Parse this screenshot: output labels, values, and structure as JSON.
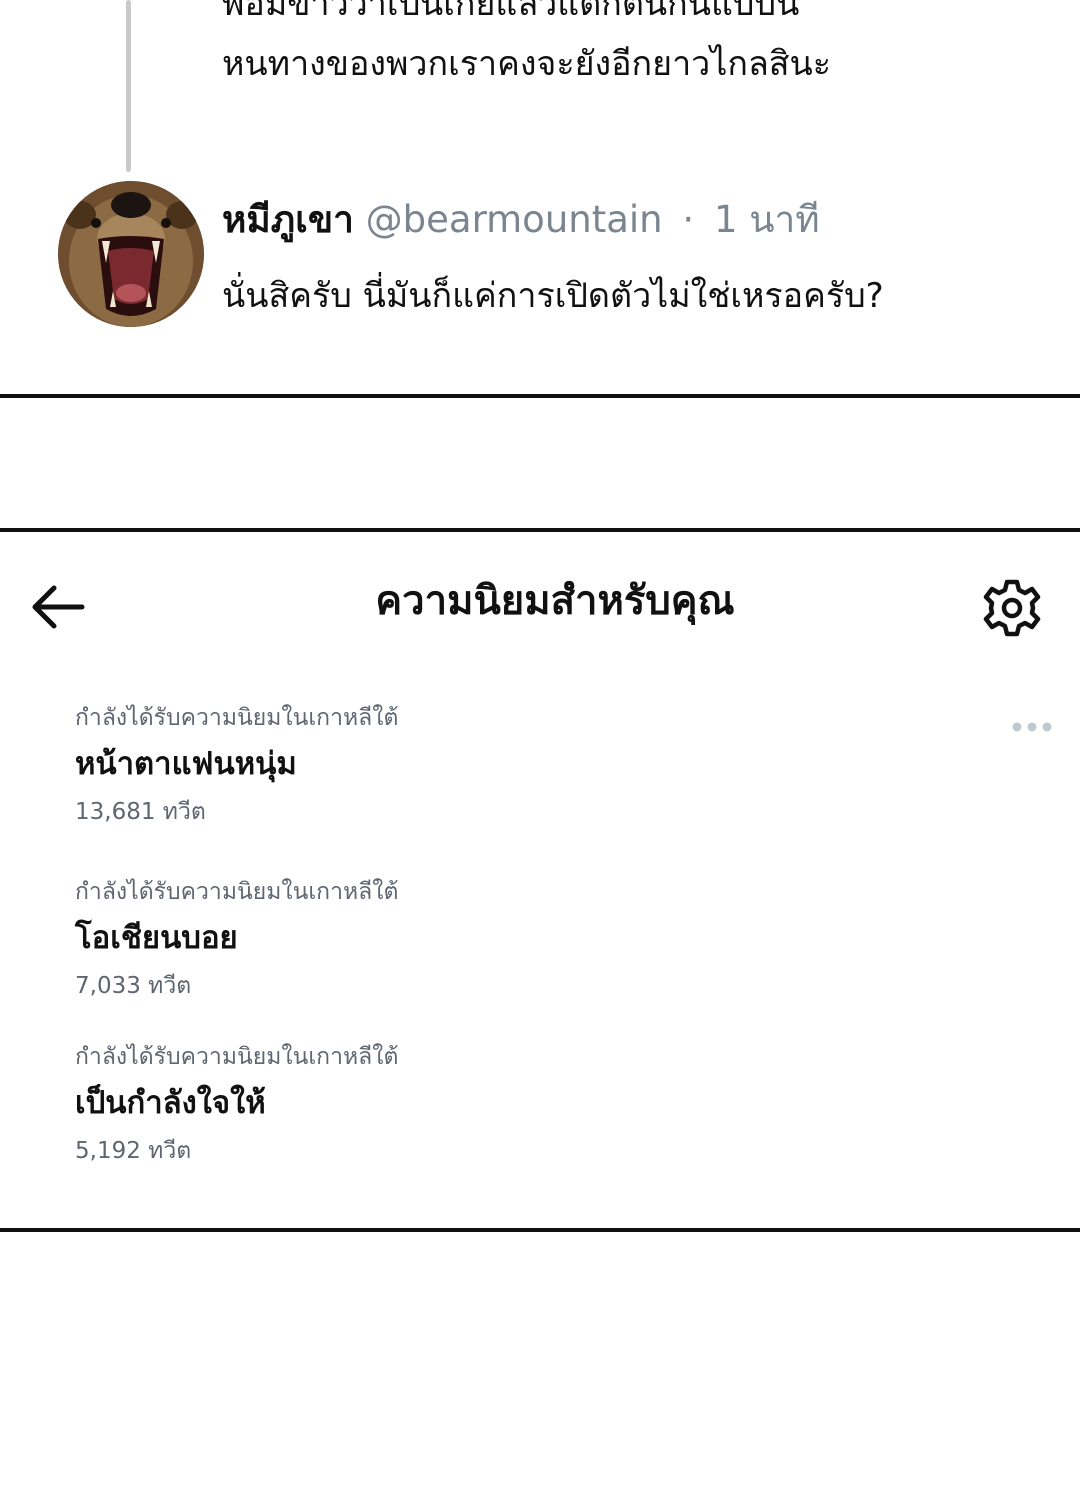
{
  "thread": {
    "previous_reply_lines": [
      "พอมีข่าวว่าเป็นเกย์แล้วแตกตื่นกันแบบนี้",
      "หนทางของพวกเราคงจะยังอีกยาวไกลสินะ"
    ]
  },
  "tweet": {
    "display_name": "หมีภูเขา",
    "handle": "@bearmountain",
    "separator": "·",
    "time": "1 นาที",
    "text": "นั่นสิครับ นี่มันก็แค่การเปิดตัวไม่ใช่เหรอครับ?",
    "avatar_icon": "roaring-bear-avatar"
  },
  "trends_panel": {
    "back_icon": "arrow-left-icon",
    "title": "ความนิยมสำหรับคุณ",
    "settings_icon": "gear-icon",
    "more_icon": "more-horizontal-icon",
    "items": [
      {
        "context": "กำลังได้รับความนิยมในเกาหลีใต้",
        "topic": "หน้าตาแฟนหนุ่ม",
        "count": "13,681 ทวีต"
      },
      {
        "context": "กำลังได้รับความนิยมในเกาหลีใต้",
        "topic": "โอเชียนบอย",
        "count": "7,033 ทวีต"
      },
      {
        "context": "กำลังได้รับความนิยมในเกาหลีใต้",
        "topic": "เป็นกำลังใจให้",
        "count": "5,192 ทวีต"
      }
    ]
  },
  "colors": {
    "text": "#111111",
    "muted": "#7b8590",
    "thread_line": "#c9c9c9",
    "divider": "#111111"
  }
}
